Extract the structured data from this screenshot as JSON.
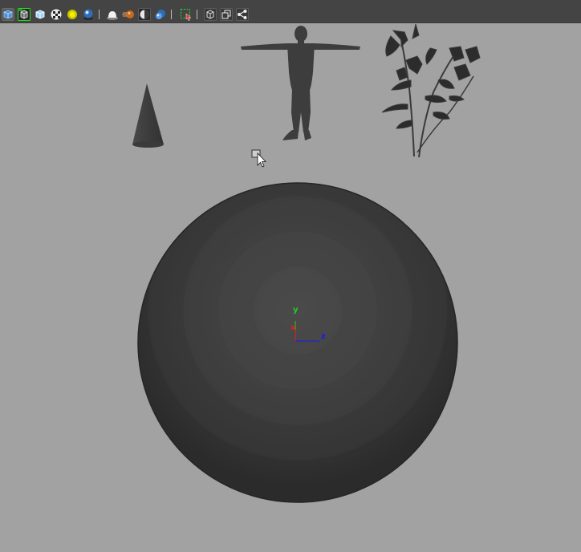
{
  "toolbar": {
    "buttons": [
      {
        "id": "shaded-mode",
        "icon": "shaded-cube-icon"
      },
      {
        "id": "wireframe-on-shaded",
        "icon": "wireframe-select-icon",
        "active": true
      },
      {
        "id": "xray-mode",
        "icon": "xray-cube-icon"
      },
      {
        "id": "textured-mode",
        "icon": "checker-texture-icon"
      },
      {
        "id": "use-all-lights",
        "icon": "light-bulb-icon"
      },
      {
        "id": "shadows",
        "icon": "shadow-sphere-icon"
      },
      {
        "id": "screen-space-ao",
        "icon": "ambient-occlusion-icon"
      },
      {
        "id": "motion-blur",
        "icon": "motion-blur-icon"
      },
      {
        "id": "depth-of-field",
        "icon": "half-sphere-icon"
      },
      {
        "id": "anti-aliasing",
        "icon": "blue-sphere-icon"
      },
      {
        "id": "isolate-select",
        "icon": "isolate-select-icon"
      },
      {
        "id": "xray-active-components",
        "icon": "box-outline-icon"
      },
      {
        "id": "xray-joints",
        "icon": "stacked-boxes-icon"
      },
      {
        "id": "share-panel",
        "icon": "share-icon"
      }
    ]
  },
  "axis": {
    "x": "x",
    "y": "y",
    "z": "z",
    "x_color": "#e02020",
    "y_color": "#1ed01e",
    "z_color": "#1a1aee"
  },
  "colors": {
    "viewport_bg": "#a2a2a2",
    "toolbar_bg": "#444444",
    "mesh": "#404040",
    "highlight": "#22dd22"
  },
  "scene_objects": [
    "cone",
    "human-figure",
    "plant",
    "sphere"
  ]
}
